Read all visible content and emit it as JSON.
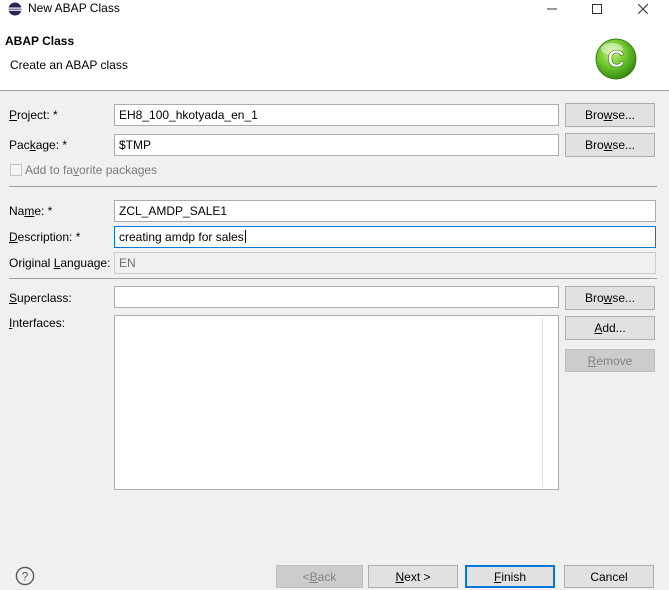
{
  "window": {
    "title": "New ABAP Class",
    "icon": "eclipse-icon",
    "controls": [
      "minimize-icon",
      "maximize-icon",
      "close-icon"
    ]
  },
  "banner": {
    "title": "ABAP Class",
    "subtitle": "Create an ABAP class",
    "logo_letter": "C",
    "logo_color": "#5cb82b"
  },
  "form": {
    "project": {
      "label_pre": "",
      "label_u": "P",
      "label_post": "roject: *",
      "value": "EH8_100_hkotyada_en_1",
      "browse_pre": "Bro",
      "browse_u": "w",
      "browse_post": "se..."
    },
    "package": {
      "label_pre": "Pac",
      "label_u": "k",
      "label_post": "age: *",
      "value": "$TMP",
      "browse_pre": "Bro",
      "browse_u": "w",
      "browse_post": "se..."
    },
    "favorite": {
      "label_pre": "Add to fa",
      "label_u": "v",
      "label_post": "orite packages",
      "checked": false
    },
    "name": {
      "label_pre": "Na",
      "label_u": "m",
      "label_post": "e: *",
      "value": "ZCL_AMDP_SALE1"
    },
    "description": {
      "label_pre": "",
      "label_u": "D",
      "label_post": "escription: *",
      "value": "creating amdp for sales"
    },
    "original_language": {
      "label_pre": "Original ",
      "label_u": "L",
      "label_post": "anguage:",
      "value": "EN"
    },
    "superclass": {
      "label_pre": "",
      "label_u": "S",
      "label_post": "uperclass:",
      "value": "",
      "browse_pre": "Bro",
      "browse_u": "w",
      "browse_post": "se..."
    },
    "interfaces": {
      "label_pre": "",
      "label_u": "I",
      "label_post": "nterfaces:",
      "items": [],
      "add_pre": "",
      "add_u": "A",
      "add_post": "dd...",
      "remove_pre": "",
      "remove_u": "R",
      "remove_post": "emove"
    }
  },
  "footer": {
    "back_pre": "< ",
    "back_u": "B",
    "back_post": "ack",
    "next_pre": "",
    "next_u": "N",
    "next_post": "ext >",
    "finish_pre": "",
    "finish_u": "F",
    "finish_post": "inish",
    "cancel_label": "Cancel",
    "help_icon": "help-icon",
    "help_symbol": "?"
  },
  "colors": {
    "accent": "#0078d7",
    "banner_bg": "#ffffff",
    "dialog_bg": "#f0f0f0"
  }
}
